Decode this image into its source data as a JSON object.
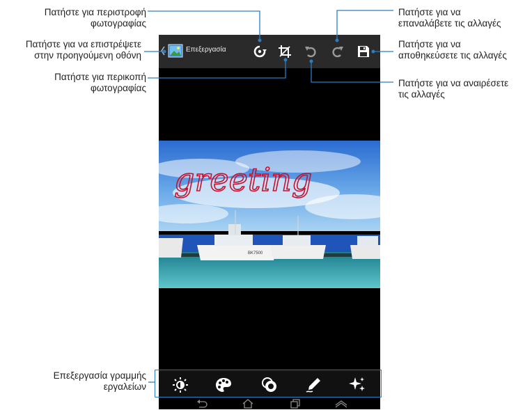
{
  "annotations": {
    "rotate": [
      "Πατήστε για περιστροφή",
      "φωτογραφίας"
    ],
    "back": [
      "Πατήστε για να επιστρέψετε",
      "στην προηγούμενη οθόνη"
    ],
    "crop": [
      "Πατήστε για περικοπή",
      "φωτογραφίας"
    ],
    "redo": [
      "Πατήστε για να",
      "επαναλάβετε τις αλλαγές"
    ],
    "save": [
      "Πατήστε για να",
      "αποθηκεύσετε τις αλλαγές"
    ],
    "undo": [
      "Πατήστε για να αναιρέσετε",
      "τις αλλαγές"
    ],
    "toolbar": [
      "Επεξεργασία γραμμής",
      "εργαλείων"
    ]
  },
  "actionbar": {
    "title": "Επεξεργασία"
  },
  "photo": {
    "handwriting": "greeting",
    "boat_label": "BK7500"
  },
  "icons": {
    "back": "chevron-left-icon",
    "app": "gallery-app-icon",
    "rotate": "rotate-icon",
    "crop": "crop-icon",
    "undo": "undo-icon",
    "redo": "redo-icon",
    "save": "save-icon",
    "brightness": "brightness-icon",
    "color": "palette-icon",
    "effects": "filter-effects-icon",
    "draw": "pen-draw-icon",
    "sparkle": "sparkle-effects-icon",
    "nav_back": "nav-back-icon",
    "nav_home": "nav-home-icon",
    "nav_recent": "nav-recent-apps-icon",
    "nav_menu": "nav-menu-icon"
  },
  "colors": {
    "accent": "#2b7cc0",
    "handwriting": "#c8102e",
    "actionbar": "#2a2a2a"
  }
}
